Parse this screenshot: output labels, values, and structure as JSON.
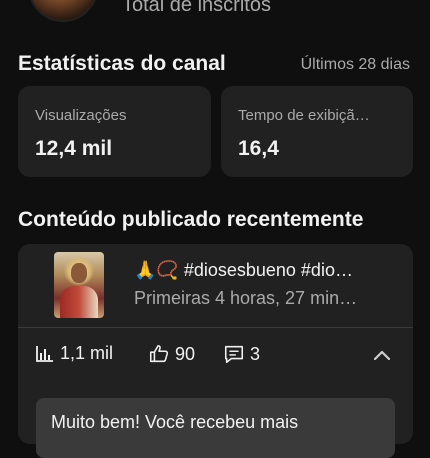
{
  "header": {
    "subscribers_label": "Total de inscritos"
  },
  "stats": {
    "title": "Estatísticas do canal",
    "period": "Últimos 28 dias",
    "cards": [
      {
        "label": "Visualizações",
        "value": "12,4 mil"
      },
      {
        "label": "Tempo de exibiçã…",
        "value": "16,4"
      }
    ]
  },
  "recent": {
    "title": "Conteúdo publicado recentemente",
    "video": {
      "title": "🙏📿 #diosesbueno #dio…",
      "meta": "Primeiras 4 horas, 27 min…",
      "views": "1,1 mil",
      "likes": "90",
      "comments": "3"
    },
    "notice": "Muito bem! Você recebeu mais"
  },
  "colors": {
    "background": "#0f0f0f",
    "card": "#212121",
    "notice": "#3a3a3a",
    "secondary_text": "#aaaaaa"
  },
  "icons": [
    "bar-chart-icon",
    "thumb-up-icon",
    "comment-icon",
    "chevron-up-icon"
  ]
}
